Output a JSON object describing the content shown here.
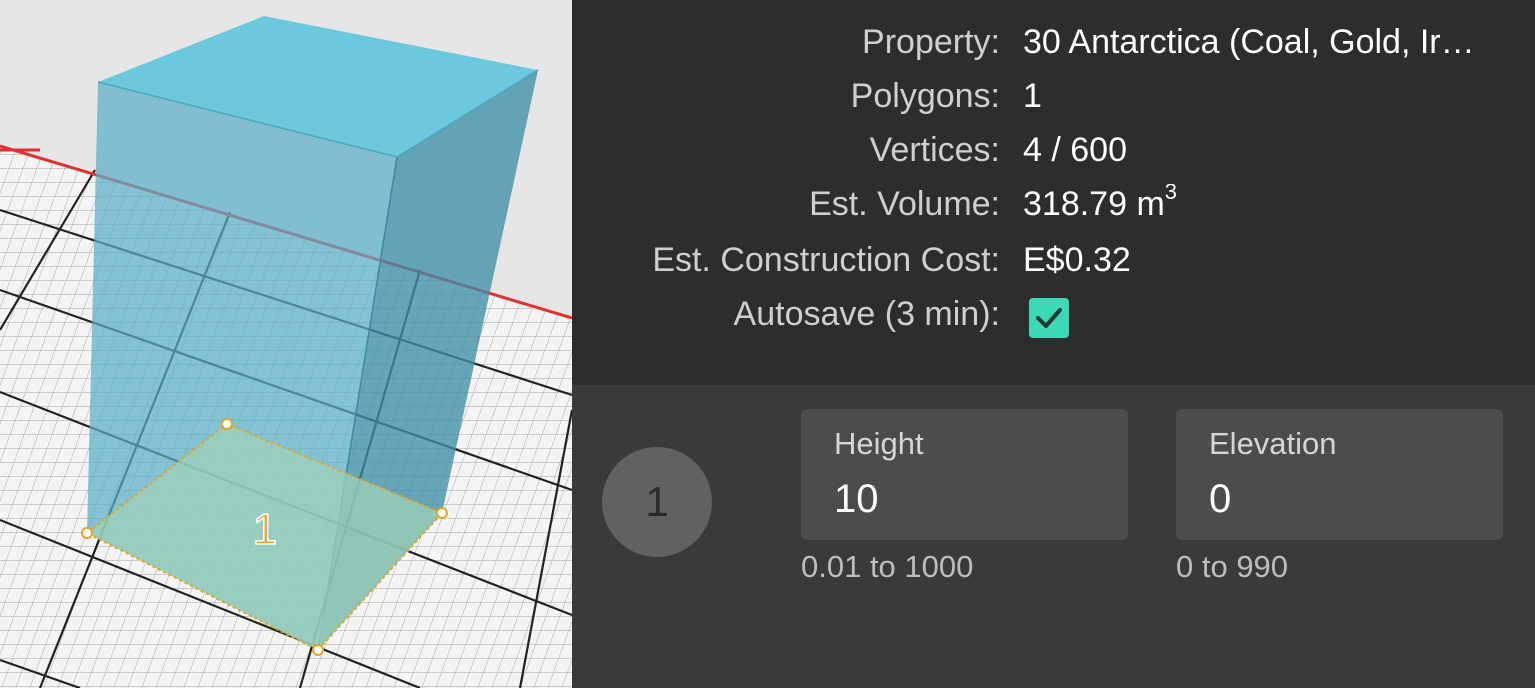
{
  "viewport": {
    "polygon_label": "1",
    "colors": {
      "background": "#e6e6e6",
      "prism": "#5fbfd6",
      "footprint": "#9fd0b8",
      "boundary": "#e03030",
      "vertex": "#f0a020"
    }
  },
  "info": {
    "property_label": "Property:",
    "property_value": "30 Antarctica (Coal, Gold, Ir…",
    "polygons_label": "Polygons:",
    "polygons_value": "1",
    "vertices_label": "Vertices:",
    "vertices_value": "4 / 600",
    "volume_label": "Est. Volume:",
    "volume_value": "318.79 m",
    "volume_unit_exp": "3",
    "cost_label": "Est. Construction Cost:",
    "cost_value": "E$0.32",
    "autosave_label": "Autosave (3 min):",
    "autosave_checked": true
  },
  "editor": {
    "polygon_number": "1",
    "height": {
      "label": "Height",
      "value": "10",
      "range": "0.01 to 1000"
    },
    "elevation": {
      "label": "Elevation",
      "value": "0",
      "range": "0 to 990"
    }
  },
  "colors": {
    "accent": "#3dd9b7",
    "panel_bg": "#2d2d2d",
    "editor_bg": "#3a3a3a",
    "field_bg": "#4c4c4c"
  }
}
